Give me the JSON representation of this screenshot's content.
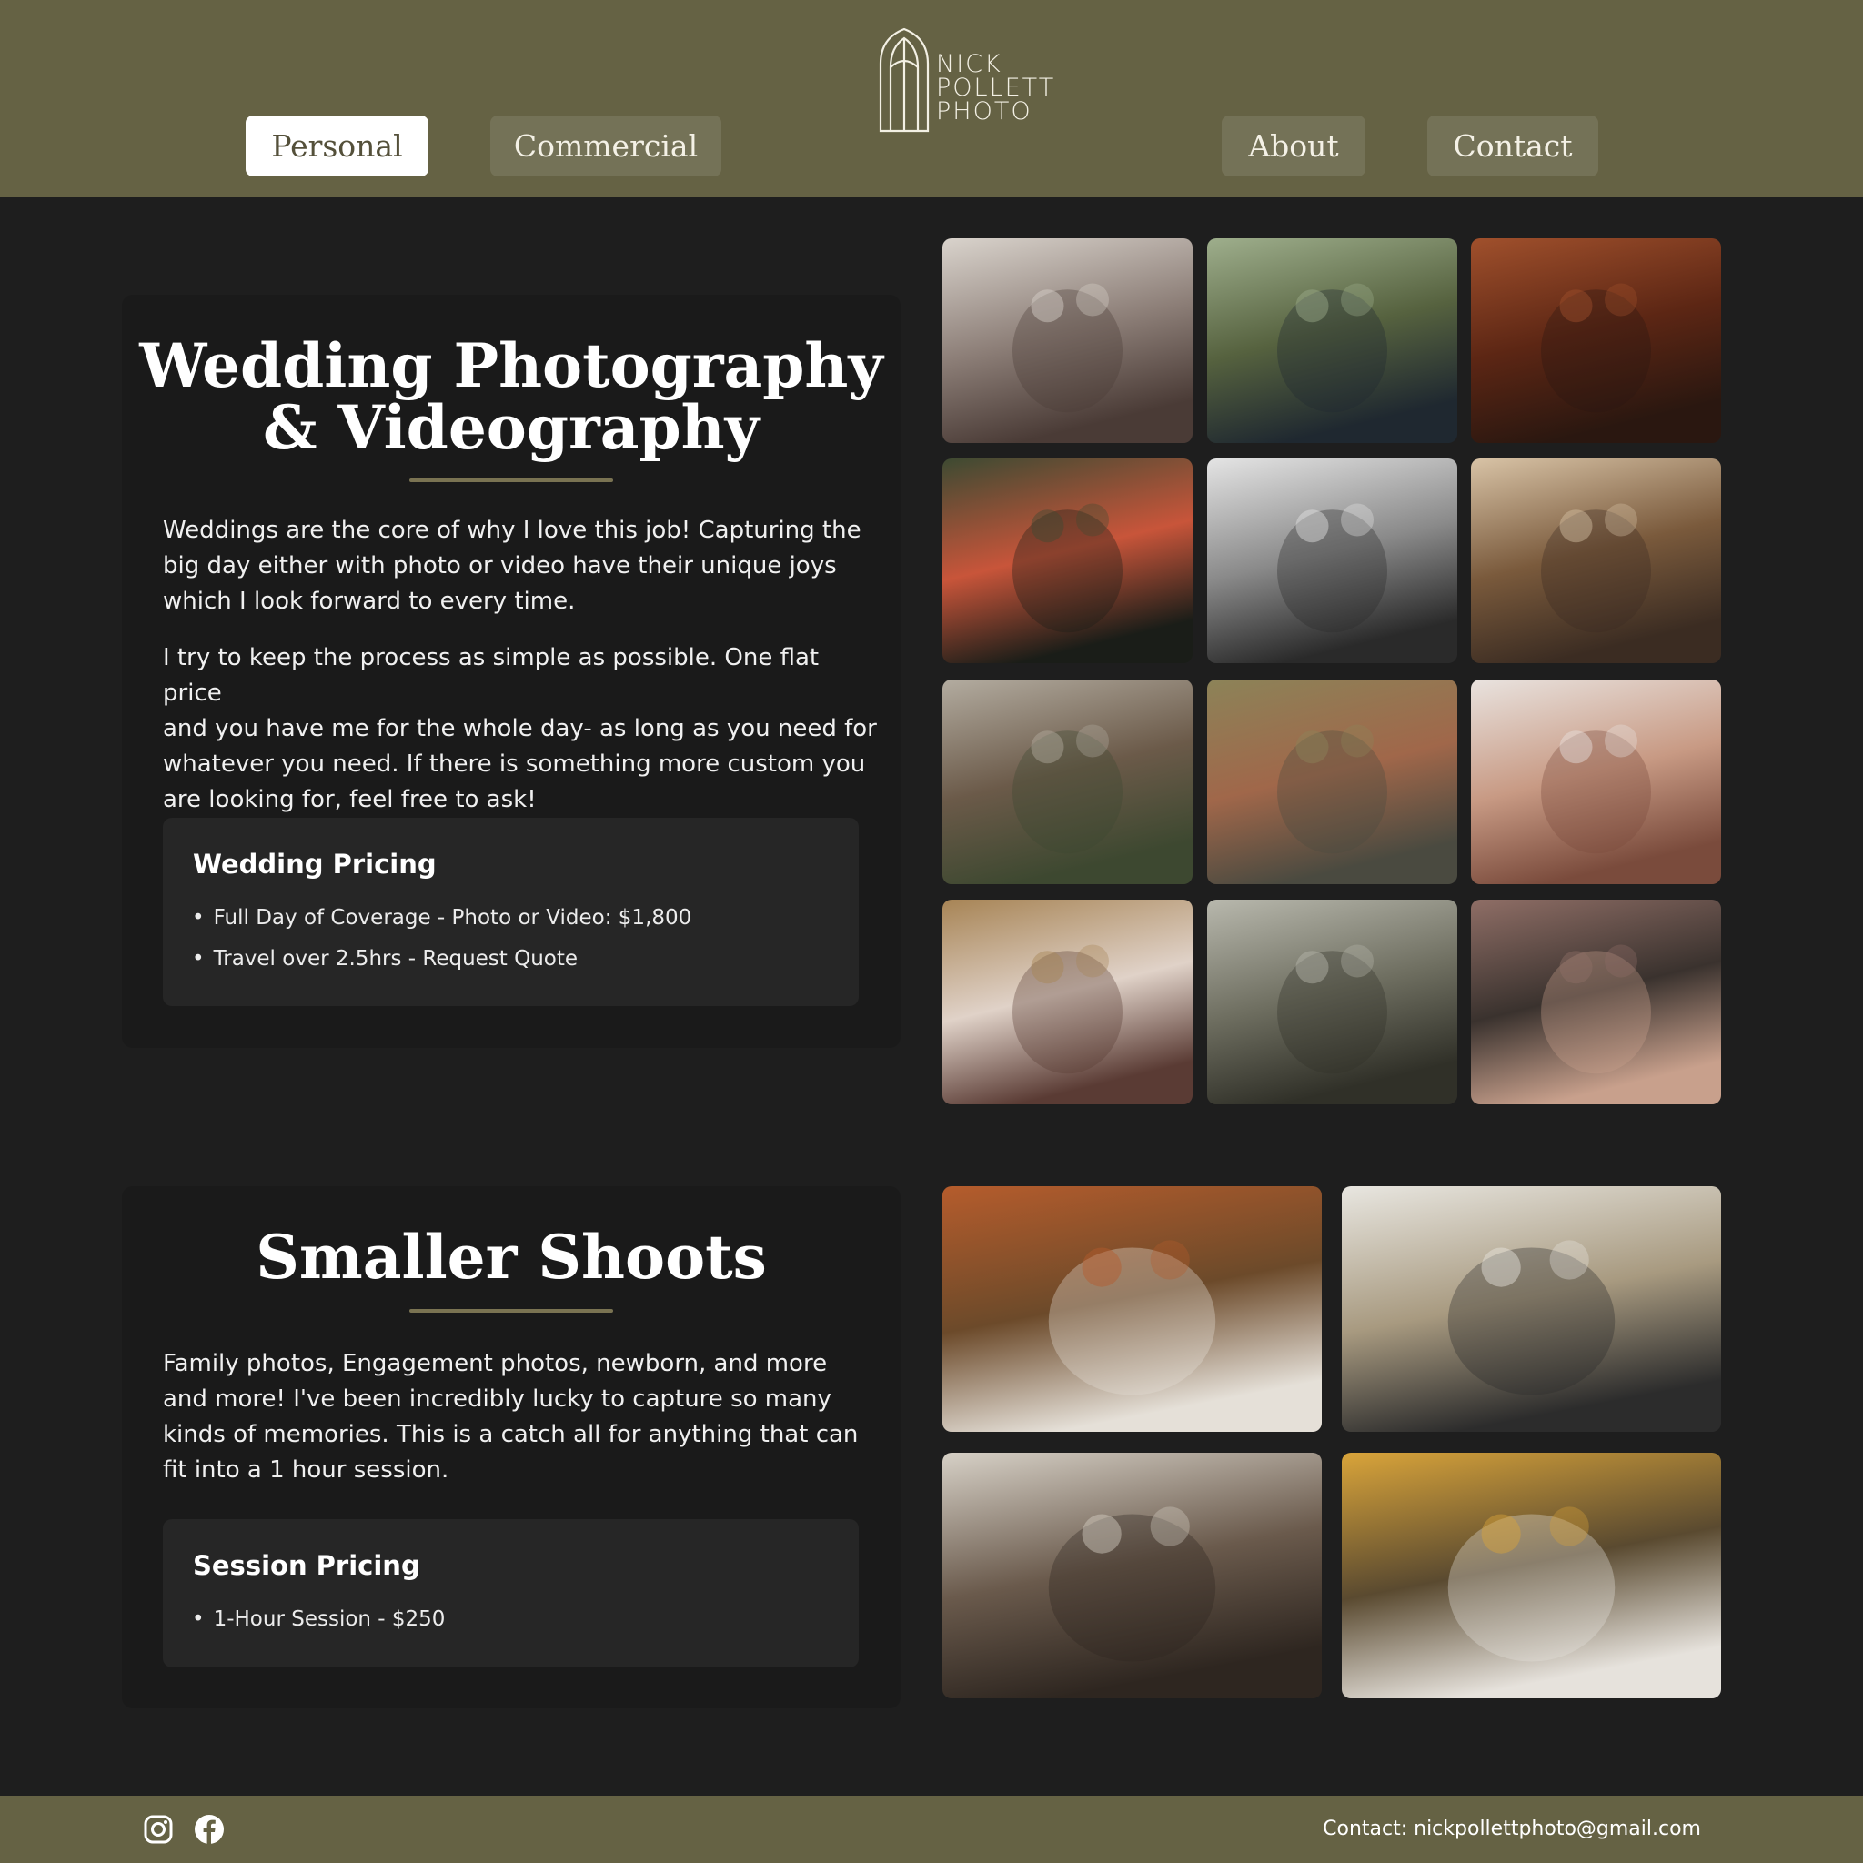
{
  "brand": {
    "logo_lines": [
      "NICK",
      "POLLETT",
      "PHOTO"
    ],
    "header_color": "#656244",
    "accent_color": "#7a7352",
    "background_color": "#1e1e1e"
  },
  "nav": {
    "personal_label": "Personal",
    "commercial_label": "Commercial",
    "about_label": "About",
    "contact_label": "Contact",
    "active": "Personal"
  },
  "wedding": {
    "title_line1": "Wedding Photography",
    "title_line2": "& Videography",
    "paragraph1_lines": [
      "Weddings are the core of why I love this job! Capturing the",
      "big day either with photo or video have their unique joys",
      "which I look forward to every time."
    ],
    "paragraph2_lines": [
      "I try to keep the process as simple as possible. One flat price",
      "and you have me for the whole day- as long as you need for",
      "whatever you need. If there is something more custom you",
      "are looking for, feel free to ask!"
    ],
    "pricing_title": "Wedding Pricing",
    "pricing_items": [
      "Full Day of Coverage - Photo or Video: $1,800",
      "Travel over 2.5hrs - Request Quote"
    ],
    "bullet": "•"
  },
  "smaller": {
    "title": "Smaller Shoots",
    "paragraph_lines": [
      "Family photos, Engagement photos, newborn, and more",
      "and more! I've been incredibly lucky to capture so many",
      "kinds of memories. This is a catch all for anything that can",
      "fit into a 1 hour session."
    ],
    "pricing_title": "Session Pricing",
    "pricing_items": [
      "1-Hour Session - $250"
    ],
    "bullet": "•"
  },
  "wedding_gallery": [
    {
      "name": "bridesmaids-on-bed-photo",
      "palette": [
        "#d9d3cc",
        "#8d7f78",
        "#4a3b36"
      ]
    },
    {
      "name": "couple-by-river-photo",
      "palette": [
        "#9eae8c",
        "#56623f",
        "#1f2830"
      ]
    },
    {
      "name": "reception-hall-photo",
      "palette": [
        "#a0502c",
        "#5c2614",
        "#2a1710"
      ]
    },
    {
      "name": "sparkler-exit-photo",
      "palette": [
        "#3d4a32",
        "#c8553a",
        "#1a1d18"
      ]
    },
    {
      "name": "groom-black-white-photo",
      "palette": [
        "#e4e4e4",
        "#8a8a8a",
        "#2a2a2a"
      ]
    },
    {
      "name": "church-ceremony-photo",
      "palette": [
        "#d8c3a6",
        "#7a5a3c",
        "#3b2c22"
      ]
    },
    {
      "name": "group-at-castle-photo",
      "palette": [
        "#b3aca0",
        "#6b5a49",
        "#3d4830"
      ]
    },
    {
      "name": "piggyback-path-photo",
      "palette": [
        "#8c8358",
        "#a0674a",
        "#4a4a40"
      ]
    },
    {
      "name": "couple-kiss-closeup-photo",
      "palette": [
        "#e9e3df",
        "#c89a84",
        "#7a4b3c"
      ]
    },
    {
      "name": "bride-with-friend-photo",
      "palette": [
        "#a78455",
        "#e0d2c8",
        "#5a3b34"
      ]
    },
    {
      "name": "couple-embrace-bridge-photo",
      "palette": [
        "#b8b8ad",
        "#6e6e60",
        "#303028"
      ]
    },
    {
      "name": "couple-cuddle-portrait-photo",
      "palette": [
        "#8f6e66",
        "#3a322e",
        "#c8a08c"
      ]
    }
  ],
  "smaller_gallery": [
    {
      "name": "family-autumn-photo",
      "palette": [
        "#b55c2c",
        "#6c4a2a",
        "#e5e0d8"
      ]
    },
    {
      "name": "family-walk-snow-photo",
      "palette": [
        "#e8e6e0",
        "#a89a80",
        "#2c2c2c"
      ]
    },
    {
      "name": "family-on-bed-photo",
      "palette": [
        "#d6d0c6",
        "#6a5a4c",
        "#2e2620"
      ]
    },
    {
      "name": "dad-with-toddler-photo",
      "palette": [
        "#d9a43a",
        "#5a4a30",
        "#e6e2dc"
      ]
    }
  ],
  "footer": {
    "contact_text": "Contact: nickpollettphoto@gmail.com",
    "instagram_icon": "instagram-icon",
    "facebook_icon": "facebook-icon"
  }
}
